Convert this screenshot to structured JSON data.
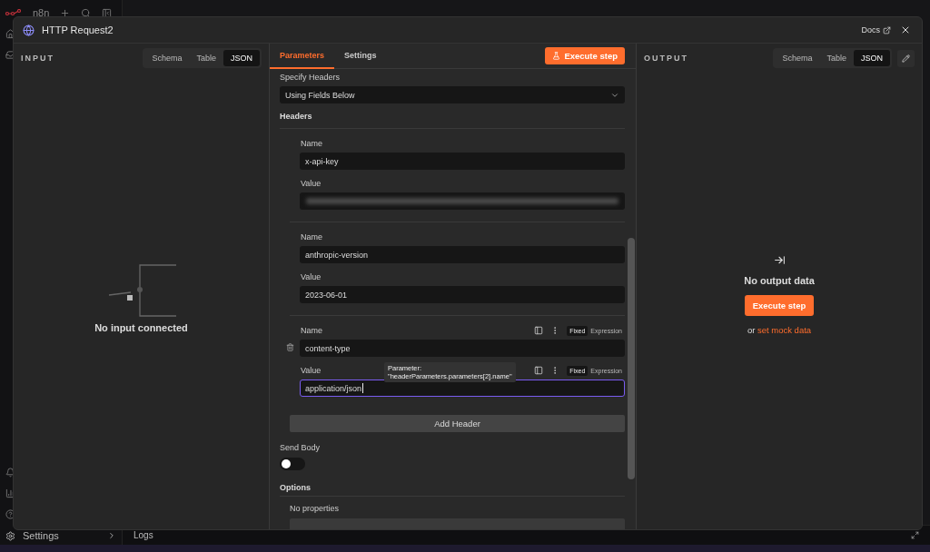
{
  "app": {
    "logo": "n8n",
    "settings_label": "Settings",
    "logs_label": "Logs"
  },
  "node": {
    "title": "HTTP Request2",
    "docs": "Docs"
  },
  "input": {
    "heading": "INPUT",
    "views": [
      {
        "label": "Schema",
        "selected": false
      },
      {
        "label": "Table",
        "selected": false
      },
      {
        "label": "JSON",
        "selected": true
      }
    ],
    "empty_message": "No input connected"
  },
  "parameters": {
    "tabs": [
      {
        "label": "Parameters",
        "selected": true
      },
      {
        "label": "Settings",
        "selected": false
      }
    ],
    "execute_button": "Execute step",
    "specify_headers": {
      "label": "Specify Headers",
      "value": "Using Fields Below"
    },
    "headers_label": "Headers",
    "headers": [
      {
        "name_label": "Name",
        "name": "x-api-key",
        "value_label": "Value",
        "value_hidden": true,
        "hovered": false,
        "focused": false
      },
      {
        "name_label": "Name",
        "name": "anthropic-version",
        "value_label": "Value",
        "value": "2023-06-01",
        "value_hidden": false,
        "hovered": false,
        "focused": false
      },
      {
        "name_label": "Name",
        "name": "content-type",
        "value_label": "Value",
        "value": "application/json",
        "value_hidden": false,
        "hovered": true,
        "focused": true,
        "name_modes": [
          {
            "label": "Fixed",
            "selected": true
          },
          {
            "label": "Expression",
            "selected": false
          }
        ],
        "value_modes": [
          {
            "label": "Fixed",
            "selected": true
          },
          {
            "label": "Expression",
            "selected": false
          }
        ],
        "tooltip": [
          "Parameter:",
          "\"headerParameters.parameters[2].name\""
        ]
      }
    ],
    "add_header": "Add Header",
    "send_body": {
      "label": "Send Body",
      "on": false
    },
    "options": {
      "label": "Options",
      "empty": "No properties"
    }
  },
  "output": {
    "heading": "OUTPUT",
    "views": [
      {
        "label": "Schema",
        "selected": false
      },
      {
        "label": "Table",
        "selected": false
      },
      {
        "label": "JSON",
        "selected": true
      }
    ],
    "empty_title": "No output data",
    "execute_button": "Execute step",
    "mock_prefix": "or",
    "mock_link": "set mock data"
  }
}
